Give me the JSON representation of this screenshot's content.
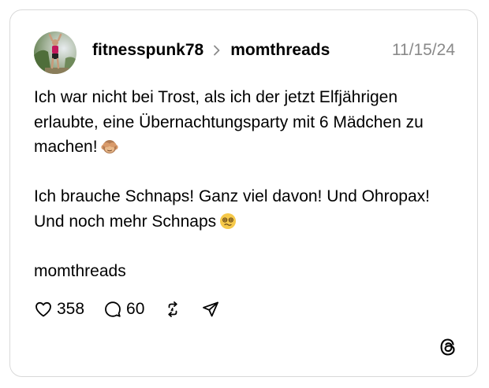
{
  "post": {
    "username": "fitnesspunk78",
    "community": "momthreads",
    "date": "11/15/24",
    "paragraphs": [
      {
        "text": "Ich war nicht bei Trost, als ich der jetzt Elfjährigen erlaubte, eine Übernachtungsparty mit 6 Mädchen zu machen!",
        "emoji": "see-no-evil-monkey-emoji"
      },
      {
        "text": "Ich brauche Schnaps! Ganz viel davon! Und Ohropax! Und noch mehr Schnaps",
        "emoji": "woozy-face-emoji"
      },
      {
        "text": "momthreads",
        "emoji": null
      }
    ]
  },
  "actions": {
    "likes": "358",
    "replies": "60"
  },
  "icons": [
    "avatar",
    "chevron-right-icon",
    "heart-icon",
    "comment-icon",
    "repost-icon",
    "share-icon",
    "threads-logo-icon"
  ],
  "colors": {
    "text": "#000000",
    "muted": "#8a8a8a",
    "border": "#d9d9d9",
    "background": "#ffffff"
  }
}
